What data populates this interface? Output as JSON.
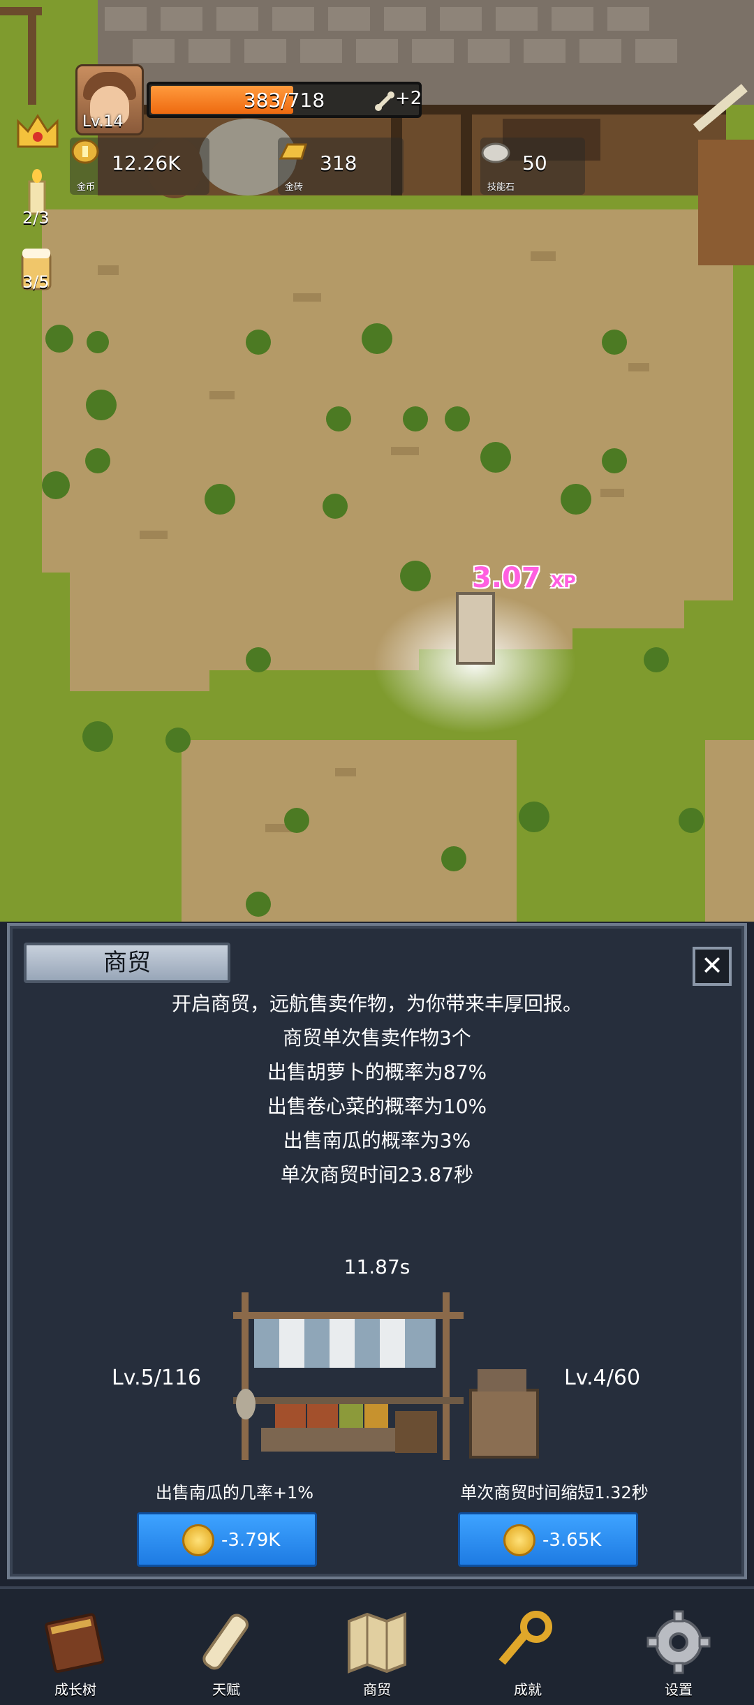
{
  "hud": {
    "level": "Lv.14",
    "xp_text": "383/718",
    "xp_fraction": 0.533,
    "xp_bonus": "+2",
    "resources": [
      {
        "icon": "gold-coin-icon",
        "value": "12.26K",
        "caption": "金币"
      },
      {
        "icon": "gold-bar-icon",
        "value": "318",
        "caption": "金砖"
      },
      {
        "icon": "skill-stone-icon",
        "value": "50",
        "caption": "技能石"
      }
    ],
    "side_badges": [
      {
        "icon": "candle-icon",
        "value": "2/3"
      },
      {
        "icon": "beer-mug-icon",
        "value": "3/5"
      }
    ]
  },
  "floating_xp": {
    "value": "3.07",
    "unit": "XP"
  },
  "panel": {
    "title": "商贸",
    "close_icon": "close-x-icon",
    "description": [
      "开启商贸，远航售卖作物，为你带来丰厚回报。",
      "商贸单次售卖作物3个",
      "出售胡萝卜的概率为87%",
      "出售卷心菜的概率为10%",
      "出售南瓜的概率为3%",
      "单次商贸时间23.87秒"
    ],
    "timer": "11.87s",
    "left_level": "Lv.5/116",
    "right_level": "Lv.4/60",
    "upgrades": [
      {
        "label": "出售南瓜的几率+1%",
        "price": "-3.79K"
      },
      {
        "label": "单次商贸时间缩短1.32秒",
        "price": "-3.65K"
      }
    ]
  },
  "nav": [
    {
      "icon": "book-icon",
      "label": "成长树"
    },
    {
      "icon": "scroll-icon",
      "label": "天赋"
    },
    {
      "icon": "map-icon",
      "label": "商贸"
    },
    {
      "icon": "key-icon",
      "label": "成就"
    },
    {
      "icon": "gear-icon",
      "label": "设置"
    }
  ]
}
